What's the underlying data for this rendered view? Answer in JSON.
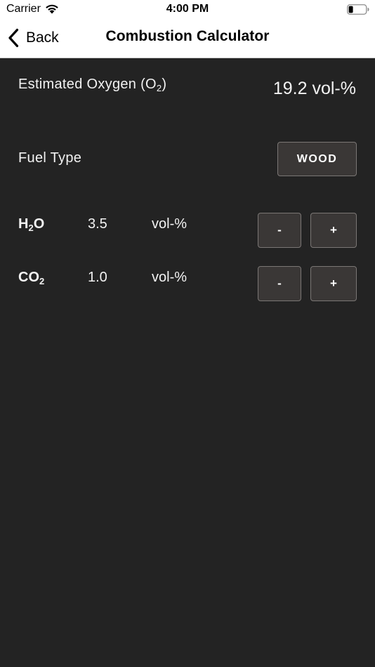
{
  "status_bar": {
    "carrier": "Carrier",
    "time": "4:00 PM"
  },
  "nav": {
    "back_label": "Back",
    "title": "Combustion Calculator"
  },
  "oxygen": {
    "label_prefix": "Estimated Oxygen (O",
    "label_sub": "2",
    "label_suffix": ")",
    "value": "19.2 vol-%"
  },
  "fuel": {
    "label": "Fuel Type",
    "button_label": "WOOD"
  },
  "gases": [
    {
      "label_main": "H",
      "label_sub": "2",
      "label_tail": "O",
      "value": "3.5",
      "unit": "vol-%",
      "minus_label": "-",
      "plus_label": "+"
    },
    {
      "label_main": "CO",
      "label_sub": "2",
      "label_tail": "",
      "value": "1.0",
      "unit": "vol-%",
      "minus_label": "-",
      "plus_label": "+"
    }
  ],
  "colors": {
    "background": "#232323",
    "button_fill": "#3a3736",
    "button_border": "#7b7775",
    "text": "#f2f2f2",
    "nav_background": "#ffffff"
  },
  "icons": {
    "wifi": "wifi-icon",
    "battery": "battery-icon",
    "back": "chevron-left-icon"
  }
}
